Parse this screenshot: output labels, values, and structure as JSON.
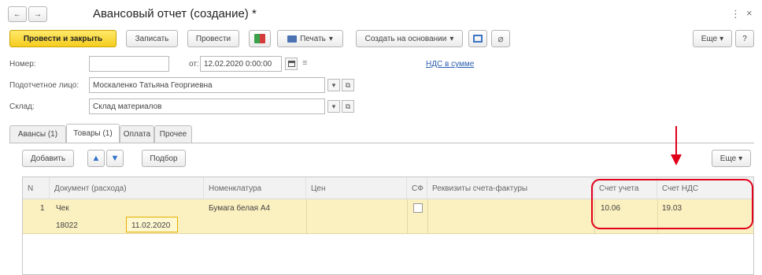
{
  "window": {
    "title": "Авансовый отчет (создание) *",
    "more_icon": "⋮",
    "close_icon": "×"
  },
  "nav": {
    "back": "←",
    "forward": "→"
  },
  "toolbar": {
    "post_close": "Провести и закрыть",
    "write": "Записать",
    "post": "Провести",
    "print": "Печать",
    "create_based": "Создать на основании",
    "more": "Еще",
    "help": "?"
  },
  "form": {
    "number_label": "Номер:",
    "number_value": "",
    "date_label": "от:",
    "date_value": "12.02.2020  0:00:00",
    "vat_link": "НДС в сумме",
    "person_label": "Подотчетное лицо:",
    "person_value": "Москаленко Татьяна Георгиевна",
    "warehouse_label": "Склад:",
    "warehouse_value": "Склад материалов"
  },
  "tabs": [
    "Авансы (1)",
    "Товары (1)",
    "Оплата",
    "Прочее"
  ],
  "table_toolbar": {
    "add": "Добавить",
    "select": "Подбор",
    "more": "Еще"
  },
  "table": {
    "headers": {
      "n": "N",
      "doc": "Документ (расхода)",
      "nom": "Номенклатура",
      "qty": "Цен",
      "sf": "СФ",
      "invoice": "Реквизиты счета-фактуры",
      "account": "Счет учета",
      "vat_account": "Счет НДС"
    },
    "row": {
      "n": "1",
      "doc": "Чек",
      "doc_number": "18022",
      "doc_date": "11.02.2020",
      "nom": "Бумага белая А4",
      "account": "10.06",
      "vat_account": "19.03"
    }
  },
  "annotation": {
    "color": "#e0001a"
  }
}
